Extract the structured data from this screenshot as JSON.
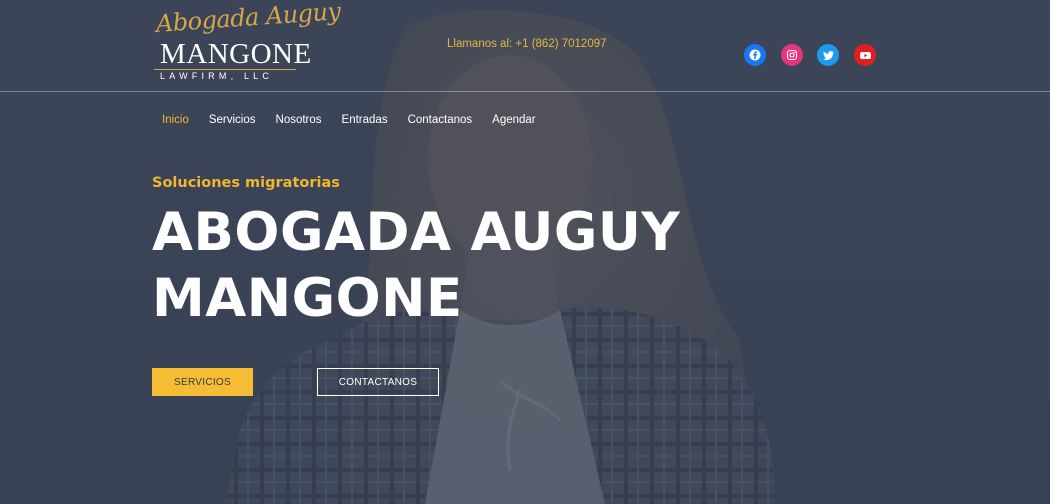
{
  "logo": {
    "script": "Abogada Auguy",
    "main": "MANGONE",
    "sub": "LAWFIRM, LLC"
  },
  "header": {
    "phone": "Llamanos al: +1 (862) 7012097"
  },
  "socials": [
    {
      "icon": "facebook-icon",
      "color": "#1877f2"
    },
    {
      "icon": "instagram-icon",
      "color": "#e4357f"
    },
    {
      "icon": "twitter-icon",
      "color": "#1d9bf0"
    },
    {
      "icon": "youtube-icon",
      "color": "#e02020"
    }
  ],
  "nav": {
    "items": [
      "Inicio",
      "Servicios",
      "Nosotros",
      "Entradas",
      "Contactanos",
      "Agendar"
    ],
    "active": "Inicio"
  },
  "hero": {
    "eyebrow": "Soluciones migratorias",
    "headline_line1": "ABOGADA AUGUY",
    "headline_line2": "MANGONE",
    "primary_button": "SERVICIOS",
    "secondary_button": "CONTACTANOS"
  },
  "colors": {
    "accent": "#f0b62e",
    "overlay": "#3d4659",
    "text": "#ffffff"
  }
}
